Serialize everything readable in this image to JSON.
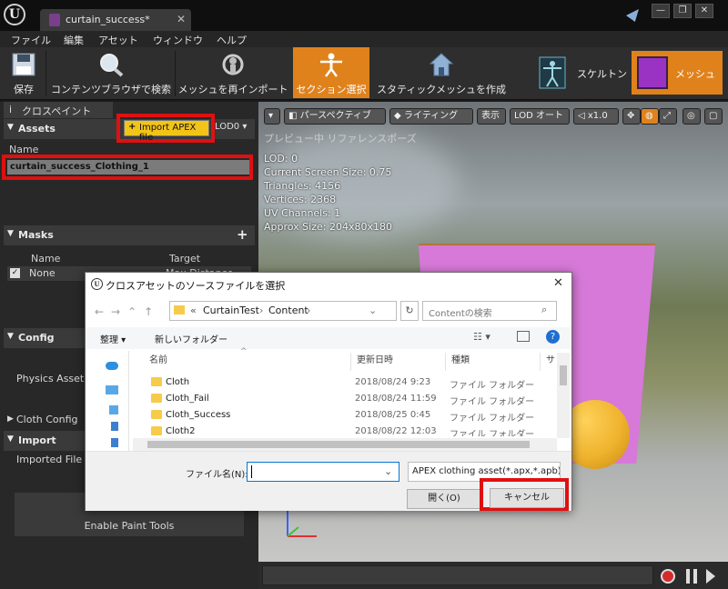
{
  "window": {
    "tab_label": "curtain_success*",
    "tab_close": "✕",
    "minimize": "—",
    "maximize": "❐",
    "close": "✕",
    "logo_glyph": "U"
  },
  "menu": [
    "ファイル",
    "編集",
    "アセット",
    "ウィンドウ",
    "ヘルプ"
  ],
  "toolbar": {
    "save": "保存",
    "browse": "コンテンツブラウザで検索",
    "reimport": "メッシュを再インポート",
    "section_select": "セクション選択",
    "static_mesh": "スタティックメッシュを作成",
    "skeleton": "スケルトン",
    "mesh": "メッシュ"
  },
  "left_panel": {
    "tab": "クロスペイント",
    "assets_header": "Assets",
    "import_button": "Import APEX file",
    "lod_dropdown": "LOD0",
    "name_col": "Name",
    "asset_item": "curtain_success_Clothing_1",
    "masks_header": "Masks",
    "masks_name_col": "Name",
    "masks_target_col": "Target",
    "mask_row_name": "None",
    "mask_row_target": "Max Distance",
    "config_header": "Config",
    "physics_asset": "Physics Asset",
    "cloth_config": "Cloth Config",
    "import_header": "Import",
    "imported_file": "Imported File Pat",
    "enable_paint": "Enable Paint Tools"
  },
  "viewport": {
    "perspective": "パースペクティブ",
    "lighting": "ライティング",
    "show": "表示",
    "lod_auto": "LOD オート",
    "speed": "x1.0",
    "preview_label": "プレビュー中 リファレンスポーズ",
    "stats": [
      "LOD: 0",
      "Current Screen Size: 0.75",
      "Triangles: 4156",
      "Vertices: 2368",
      "UV Channels: 1",
      "Approx Size: 204x80x180"
    ]
  },
  "dialog": {
    "title": "クロスアセットのソースファイルを選択",
    "close": "✕",
    "nav": "←→⌃↑",
    "path_prefix": "«",
    "path": [
      "CurtainTest",
      "Content"
    ],
    "search_placeholder": "Contentの検索",
    "organize": "整理",
    "new_folder": "新しいフォルダー",
    "columns": [
      "名前",
      "更新日時",
      "種類",
      "サ"
    ],
    "files": [
      {
        "name": "Cloth",
        "date": "2018/08/24 9:23",
        "type": "ファイル フォルダー"
      },
      {
        "name": "Cloth_Fail",
        "date": "2018/08/24 11:59",
        "type": "ファイル フォルダー"
      },
      {
        "name": "Cloth_Success",
        "date": "2018/08/25 0:45",
        "type": "ファイル フォルダー"
      },
      {
        "name": "Cloth2",
        "date": "2018/08/22 12:03",
        "type": "ファイル フォルダー"
      }
    ],
    "filename_label": "ファイル名(N):",
    "filename_value": "",
    "filetype": "APEX clothing asset(*.apx,*.apb)",
    "open_button": "開く(O)",
    "cancel_button": "キャンセル"
  },
  "colors": {
    "accent_orange": "#e0821c",
    "highlight_red": "#e01010",
    "import_yellow": "#f2c418",
    "cloth_pink": "#d779d8",
    "sphere_yellow": "#efb32e"
  },
  "icons": [
    "ue-logo-icon",
    "save-icon",
    "magnifier-icon",
    "reimport-icon",
    "section-icon",
    "house-icon",
    "skeleton-icon",
    "mesh-icon",
    "record-icon",
    "pause-icon",
    "play-icon",
    "folder-icon",
    "refresh-icon",
    "help-icon"
  ]
}
